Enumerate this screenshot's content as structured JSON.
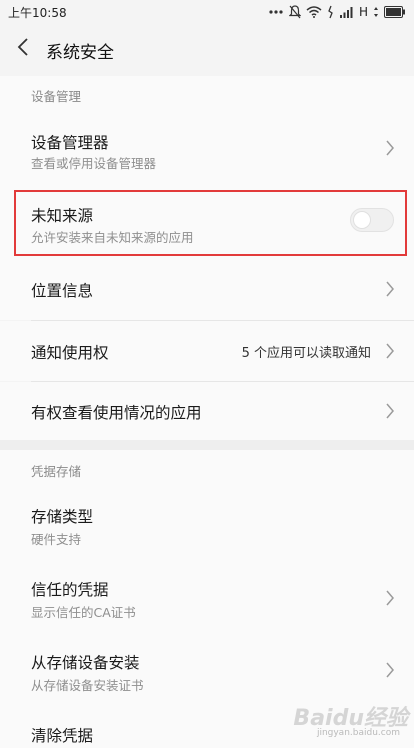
{
  "status_bar": {
    "time": "上午10:58",
    "carrier_letter": "H"
  },
  "header": {
    "title": "系统安全"
  },
  "sections": {
    "device_admin_header": "设备管理",
    "credentials_header": "凭据存储"
  },
  "rows": {
    "device_manager": {
      "title": "设备管理器",
      "subtitle": "查看或停用设备管理器"
    },
    "unknown_sources": {
      "title": "未知来源",
      "subtitle": "允许安装来自未知来源的应用",
      "enabled": false
    },
    "location": {
      "title": "位置信息"
    },
    "notification_access": {
      "title": "通知使用权",
      "value": "5 个应用可以读取通知"
    },
    "usage_access": {
      "title": "有权查看使用情况的应用"
    },
    "storage_type": {
      "title": "存储类型",
      "subtitle": "硬件支持"
    },
    "trusted_credentials": {
      "title": "信任的凭据",
      "subtitle": "显示信任的CA证书"
    },
    "install_from_storage": {
      "title": "从存储设备安装",
      "subtitle": "从存储设备安装证书"
    },
    "clear_credentials": {
      "title": "清除凭据"
    }
  },
  "watermark": {
    "main": "Baidu经验",
    "sub": "jingyan.baidu.com"
  },
  "colors": {
    "highlight_border": "#e23a3a",
    "background": "#fafafa"
  }
}
